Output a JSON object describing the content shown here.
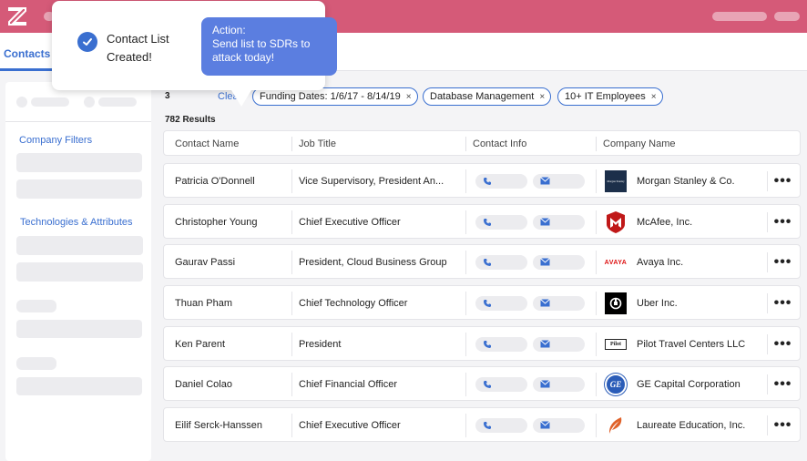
{
  "nav": {
    "tab_label": "Contacts"
  },
  "colors": {
    "topbar": "#d55a78",
    "accent": "#3a6fd0",
    "action_box": "#5b7ee0"
  },
  "sidebar": {
    "company_filters": "Company Filters",
    "technologies": "Technologies & Attributes"
  },
  "filters": {
    "count_prefix": "3",
    "clear_label": "Clear",
    "chips": [
      {
        "label": "Funding Dates: 1/6/17 - 8/14/19",
        "x": "×"
      },
      {
        "label": "Database Management",
        "x": "×"
      },
      {
        "label": "10+ IT Employees",
        "x": "×"
      }
    ]
  },
  "results_label": "782  Results",
  "table": {
    "headers": [
      "Contact Name",
      "Job Title",
      "Contact Info",
      "Company Name"
    ],
    "rows": [
      {
        "name": "Patricia O'Donnell",
        "title": "Vice Supervisory, President An...",
        "company": "Morgan Stanley & Co.",
        "logo": "morgan-stanley-logo",
        "logo_text": "Morgan Stanley",
        "more": "•••"
      },
      {
        "name": "Christopher Young",
        "title": "Chief Executive Officer",
        "company": "McAfee, Inc.",
        "logo": "mcafee-logo",
        "more": "•••"
      },
      {
        "name": "Gaurav Passi",
        "title": "President, Cloud Business Group",
        "company": "Avaya Inc.",
        "logo": "avaya-logo",
        "logo_text": "AVAYA",
        "more": "•••"
      },
      {
        "name": "Thuan Pham",
        "title": "Chief Technology Officer",
        "company": "Uber Inc.",
        "logo": "uber-logo",
        "more": "•••"
      },
      {
        "name": "Ken Parent",
        "title": "President",
        "company": "Pilot Travel Centers LLC",
        "logo": "pilot-logo",
        "logo_text": "Pilot",
        "more": "•••"
      },
      {
        "name": "Daniel Colao",
        "title": "Chief Financial Officer",
        "company": "GE Capital Corporation",
        "logo": "ge-logo",
        "logo_text": "GE",
        "more": "•••"
      },
      {
        "name": "Eilif Serck-Hanssen",
        "title": "Chief Executive Officer",
        "company": "Laureate Education, Inc.",
        "logo": "laureate-logo",
        "more": "•••"
      }
    ]
  },
  "popup": {
    "title": "Contact List Created!",
    "action_heading": "Action:",
    "action_text": "Send list to SDRs to attack today!"
  }
}
